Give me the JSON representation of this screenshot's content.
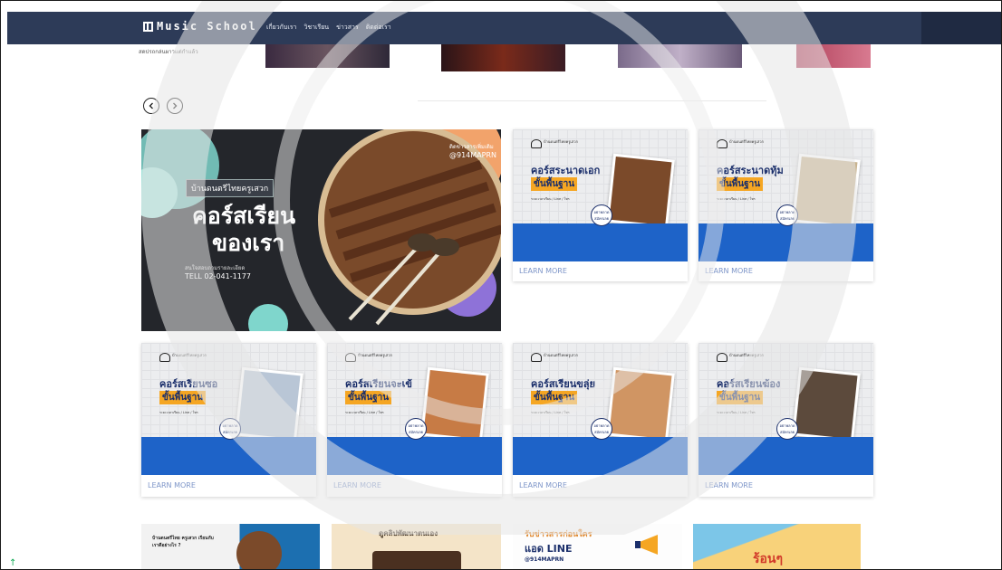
{
  "nav": {
    "brand": "Music School",
    "links": [
      "เกี่ยวกับเรา",
      "วิชาเรียน",
      "ข่าวสาร",
      "ติดต่อเรา"
    ]
  },
  "strip": {
    "text": "สดปรถกล่นผาวแต่กำแล้ว"
  },
  "hero": {
    "tag": "บ้านดนตรีไทยครูเสวก",
    "title1": "คอร์สเรียน",
    "title2": "ของเรา",
    "contact": "สนใจสอบถามรายละเอียด",
    "phone": "TELL 02-041-1177",
    "follow": "ติดข่าวสารเพิ่มเติม",
    "handle": "@914MAPRN"
  },
  "cards": [
    {
      "title": "คอร์สระนาดเอก",
      "subtitle": "ขั้นพื้นฐาน",
      "learn": "LEARN MORE",
      "photo_color": "#7b4a2a"
    },
    {
      "title": "คอร์สระนาดทุ้ม",
      "subtitle": "ขั้นพื้นฐาน",
      "learn": "LEARN MORE",
      "photo_color": "#c9b48f"
    },
    {
      "title": "คอร์สเรียนซอ",
      "subtitle": "ขั้นพื้นฐาน",
      "learn": "LEARN MORE",
      "photo_color": "#b9c6d6"
    },
    {
      "title": "คอร์สเรียนจะเข้",
      "subtitle": "ขั้นพื้นฐาน",
      "learn": "LEARN MORE",
      "photo_color": "#c77b45"
    },
    {
      "title": "คอร์สเรียนขลุ่ย",
      "subtitle": "ขั้นพื้นฐาน",
      "learn": "LEARN MORE",
      "photo_color": "#d09563"
    },
    {
      "title": "คอร์สเรียนฆ้อง",
      "subtitle": "ขั้นพื้นฐาน",
      "learn": "LEARN MORE",
      "photo_color": "#5c4a3c"
    }
  ],
  "card_info": "ระยะเวลาเรียน / Line / โทร",
  "card_badge": "อย่าพลาด สมัครเลย",
  "bottom": {
    "tile1": "บ้านดนตรีไทย ครูเสวก เรียนกับเราดีอย่างไร ?",
    "tile2": "ดูคลิปพัฒนาตนเอง",
    "tile3a": "รับข่าวสารก่อนใคร",
    "tile3b": "แอด LINE",
    "tile3c": "@914MAPRN",
    "tile4": "ร้อนๆ"
  },
  "colors": {
    "nav": "#2d3b58",
    "accent_blue": "#1e63c8",
    "accent_orange": "#f5a623",
    "title_navy": "#1b2f6b"
  }
}
